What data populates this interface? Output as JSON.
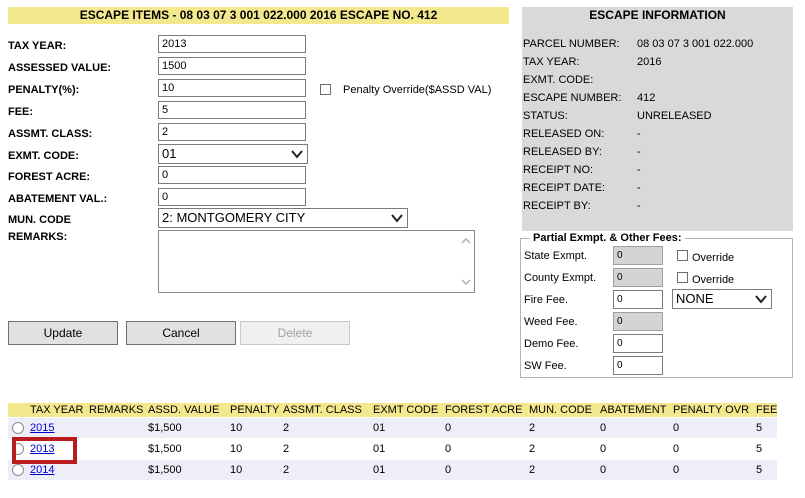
{
  "header": {
    "title": "ESCAPE ITEMS - 08 03 07 3 001 022.000   2016   ESCAPE NO.  412"
  },
  "form": {
    "tax_year_label": "TAX YEAR:",
    "tax_year": "2013",
    "assessed_label": "ASSESSED VALUE:",
    "assessed": "1500",
    "penalty_label": "PENALTY(%):",
    "penalty": "10",
    "fee_label": "FEE:",
    "fee": "5",
    "assmt_class_label": "ASSMT. CLASS:",
    "assmt_class": "2",
    "exmt_code_label": "EXMT. CODE:",
    "exmt_code": "01",
    "forest_label": "FOREST ACRE:",
    "forest": "0",
    "abatement_label": "ABATEMENT VAL.:",
    "abatement": "0",
    "mun_code_label": "MUN. CODE",
    "mun_code": "2: MONTGOMERY CITY",
    "remarks_label": "REMARKS:",
    "penalty_override_label": "Penalty Override($ASSD VAL)"
  },
  "buttons": {
    "update": "Update",
    "cancel": "Cancel",
    "delete": "Delete"
  },
  "info": {
    "title": "ESCAPE INFORMATION",
    "rows": [
      {
        "label": "PARCEL NUMBER:",
        "value": "08 03 07 3 001 022.000"
      },
      {
        "label": "TAX YEAR:",
        "value": "2016"
      },
      {
        "label": "EXMT. CODE:",
        "value": ""
      },
      {
        "label": "ESCAPE NUMBER:",
        "value": "412"
      },
      {
        "label": "STATUS:",
        "value": "UNRELEASED"
      },
      {
        "label": "RELEASED ON:",
        "value": "-"
      },
      {
        "label": "RELEASED BY:",
        "value": "-"
      },
      {
        "label": "RECEIPT NO:",
        "value": "-"
      },
      {
        "label": "RECEIPT DATE:",
        "value": "-"
      },
      {
        "label": "RECEIPT BY:",
        "value": "-"
      }
    ]
  },
  "fees": {
    "title": "Partial Exmpt. & Other Fees:",
    "override_label": "Override",
    "fire_select": "NONE",
    "rows": [
      {
        "label": "State Exmpt.",
        "value": "0"
      },
      {
        "label": "County Exmpt.",
        "value": "0"
      },
      {
        "label": "Fire Fee.",
        "value": "0"
      },
      {
        "label": "Weed Fee.",
        "value": "0"
      },
      {
        "label": "Demo Fee.",
        "value": "0"
      },
      {
        "label": "SW Fee.",
        "value": "0"
      }
    ]
  },
  "table": {
    "headers": [
      "TAX YEAR",
      "REMARKS",
      "ASSD. VALUE",
      "PENALTY",
      "ASSMT. CLASS",
      "EXMT CODE",
      "FOREST ACRE",
      "MUN. CODE",
      "ABATEMENT",
      "PENALTY OVR",
      "FEE"
    ],
    "rows": [
      {
        "year": "2015",
        "assd": "$1,500",
        "penalty": "10",
        "class": "2",
        "exmt": "01",
        "forest": "0",
        "mun": "2",
        "abate": "0",
        "povr": "0",
        "fee": "5"
      },
      {
        "year": "2013",
        "assd": "$1,500",
        "penalty": "10",
        "class": "2",
        "exmt": "01",
        "forest": "0",
        "mun": "2",
        "abate": "0",
        "povr": "0",
        "fee": "5"
      },
      {
        "year": "2014",
        "assd": "$1,500",
        "penalty": "10",
        "class": "2",
        "exmt": "01",
        "forest": "0",
        "mun": "2",
        "abate": "0",
        "povr": "0",
        "fee": "5"
      }
    ]
  },
  "colors": {
    "header_bg": "#f4e88f",
    "info_bg": "#d9d9d9",
    "highlight": "#b81c1c",
    "link": "#0000cc"
  }
}
